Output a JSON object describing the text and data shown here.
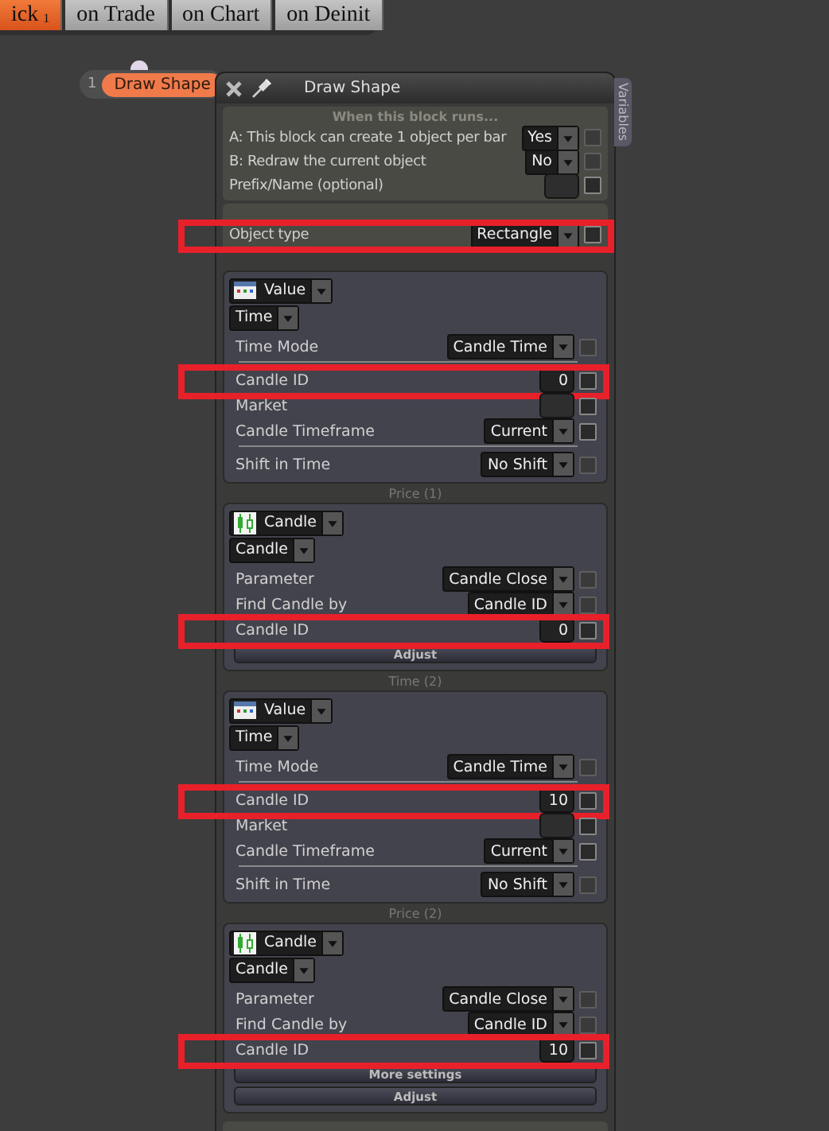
{
  "tabs": [
    {
      "label": "ick",
      "badge": "1",
      "selected": true
    },
    {
      "label": "on Trade",
      "selected": false
    },
    {
      "label": "on Chart",
      "selected": false
    },
    {
      "label": "on Deinit",
      "selected": false
    }
  ],
  "node": {
    "number": "1",
    "label": "Draw Shape"
  },
  "panel": {
    "title": "Draw Shape",
    "side_tab": "Variables",
    "sections": [
      {
        "header": "When this block runs...",
        "rows": [
          {
            "kind": "select",
            "label": "A: This block can create 1 object per bar",
            "value": "Yes",
            "checkbox_enabled": false
          },
          {
            "kind": "select",
            "label": "B: Redraw the current object",
            "value": "No",
            "checkbox_enabled": false
          },
          {
            "kind": "field",
            "label": "Prefix/Name (optional)",
            "checkbox_enabled": true
          }
        ]
      },
      {
        "rows": [
          {
            "kind": "select",
            "label": "Object type",
            "value": "Rectangle",
            "checkbox_enabled": true,
            "highlight": true
          }
        ]
      }
    ],
    "groups": [
      {
        "source": {
          "kind": "value",
          "label": "Value"
        },
        "subtype": "Time",
        "rows": [
          {
            "kind": "select",
            "label": "Time Mode",
            "value": "Candle Time",
            "checkbox_enabled": false
          },
          {
            "kind": "number",
            "label": "Candle ID",
            "value": "0",
            "checkbox_enabled": true,
            "highlight": true,
            "divider_before": true
          },
          {
            "kind": "field",
            "label": "Market",
            "checkbox_enabled": true
          },
          {
            "kind": "select",
            "label": "Candle Timeframe",
            "value": "Current",
            "checkbox_enabled": true
          },
          {
            "kind": "select",
            "label": "Shift in Time",
            "value": "No Shift",
            "checkbox_enabled": false,
            "divider_before": true
          }
        ]
      },
      {
        "header": "Price (1)",
        "source": {
          "kind": "candle",
          "label": "Candle"
        },
        "subtype": "Candle",
        "rows": [
          {
            "kind": "select",
            "label": "Parameter",
            "value": "Candle Close",
            "checkbox_enabled": false
          },
          {
            "kind": "select",
            "label": "Find Candle by",
            "value": "Candle ID",
            "checkbox_enabled": false
          },
          {
            "kind": "number",
            "label": "Candle ID",
            "value": "0",
            "checkbox_enabled": true,
            "highlight": true
          }
        ],
        "buttons": [
          "Adjust"
        ]
      },
      {
        "header": "Time (2)",
        "source": {
          "kind": "value",
          "label": "Value"
        },
        "subtype": "Time",
        "rows": [
          {
            "kind": "select",
            "label": "Time Mode",
            "value": "Candle Time",
            "checkbox_enabled": false
          },
          {
            "kind": "number",
            "label": "Candle ID",
            "value": "10",
            "checkbox_enabled": true,
            "highlight": true,
            "divider_before": true
          },
          {
            "kind": "field",
            "label": "Market",
            "checkbox_enabled": true
          },
          {
            "kind": "select",
            "label": "Candle Timeframe",
            "value": "Current",
            "checkbox_enabled": true
          },
          {
            "kind": "select",
            "label": "Shift in Time",
            "value": "No Shift",
            "checkbox_enabled": false,
            "divider_before": true
          }
        ]
      },
      {
        "header": "Price (2)",
        "source": {
          "kind": "candle",
          "label": "Candle"
        },
        "subtype": "Candle",
        "rows": [
          {
            "kind": "select",
            "label": "Parameter",
            "value": "Candle Close",
            "checkbox_enabled": false
          },
          {
            "kind": "select",
            "label": "Find Candle by",
            "value": "Candle ID",
            "checkbox_enabled": false
          },
          {
            "kind": "number",
            "label": "Candle ID",
            "value": "10",
            "checkbox_enabled": true,
            "highlight": true
          }
        ],
        "buttons": [
          "More settings",
          "Adjust"
        ]
      }
    ]
  }
}
